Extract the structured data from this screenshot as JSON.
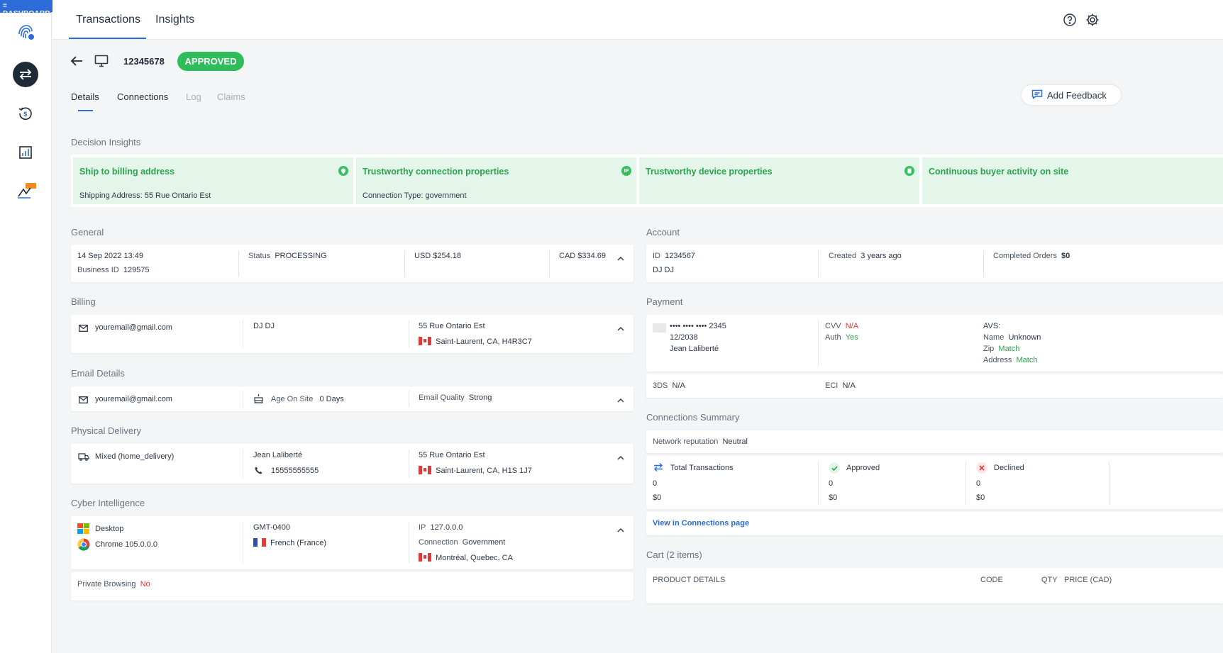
{
  "sidebar": {
    "badge": "= DASHBOARD",
    "beta": "BETA"
  },
  "top_tabs": [
    "Transactions",
    "Insights"
  ],
  "header": {
    "transaction_id": "12345678",
    "status": "APPROVED"
  },
  "sub_tabs": [
    "Details",
    "Connections",
    "Log",
    "Claims"
  ],
  "add_feedback": "Add Feedback",
  "decision_insights": {
    "title": "Decision Insights",
    "items": [
      {
        "title": "Ship to billing address",
        "detail": "Shipping Address: 55 Rue Ontario Est"
      },
      {
        "title": "Trustworthy connection properties",
        "detail": "Connection Type: government",
        "icon_text": "IP"
      },
      {
        "title": "Trustworthy device properties",
        "detail": ""
      },
      {
        "title": "Continuous buyer activity on site",
        "detail": ""
      }
    ]
  },
  "general": {
    "title": "General",
    "date": "14 Sep 2022 13:49",
    "business_id_label": "Business ID",
    "business_id": "129575",
    "status_label": "Status",
    "status": "PROCESSING",
    "usd": "USD $254.18",
    "cad": "CAD $334.69"
  },
  "billing": {
    "title": "Billing",
    "email": "youremail@gmail.com",
    "name": "DJ DJ",
    "address1": "55 Rue Ontario Est",
    "address2": "Saint-Laurent, CA, H4R3C7"
  },
  "email_details": {
    "title": "Email Details",
    "email": "youremail@gmail.com",
    "age_label": "Age On Site",
    "age": "0 Days",
    "quality_label": "Email Quality",
    "quality": "Strong"
  },
  "physical_delivery": {
    "title": "Physical Delivery",
    "method": "Mixed (home_delivery)",
    "name": "Jean Laliberté",
    "phone": "15555555555",
    "address1": "55 Rue Ontario Est",
    "address2": "Saint-Laurent, CA, H1S 1J7"
  },
  "cyber": {
    "title": "Cyber Intelligence",
    "device": "Desktop",
    "browser": "Chrome 105.0.0.0",
    "timezone": "GMT-0400",
    "language": "French (France)",
    "ip_label": "IP",
    "ip": "127.0.0.0",
    "connection_label": "Connection",
    "connection": "Government",
    "location": "Montréal, Quebec, CA",
    "private_label": "Private Browsing",
    "private": "No"
  },
  "account": {
    "title": "Account",
    "id_label": "ID",
    "id": "1234567",
    "name": "DJ DJ",
    "created_label": "Created",
    "created": "3 years ago",
    "orders_label": "Completed Orders",
    "orders": "$0"
  },
  "payment": {
    "title": "Payment",
    "card": "•••• •••• •••• 2345",
    "expiry": "12/2038",
    "holder": "Jean Laliberté",
    "cvv_label": "CVV",
    "cvv": "N/A",
    "auth_label": "Auth",
    "auth": "Yes",
    "avs_label": "AVS:",
    "avs_name_label": "Name",
    "avs_name": "Unknown",
    "avs_zip_label": "Zip",
    "avs_zip": "Match",
    "avs_address_label": "Address",
    "avs_address": "Match",
    "threeds_label": "3DS",
    "threeds": "N/A",
    "eci_label": "ECI",
    "eci": "N/A"
  },
  "connections_summary": {
    "title": "Connections Summary",
    "reputation_label": "Network reputation",
    "reputation": "Neutral",
    "total_label": "Total Transactions",
    "total_count": "0",
    "total_amount": "$0",
    "approved_label": "Approved",
    "approved_count": "0",
    "approved_amount": "$0",
    "declined_label": "Declined",
    "declined_count": "0",
    "declined_amount": "$0",
    "link": "View in Connections page"
  },
  "cart": {
    "title": "Cart (2 items)",
    "columns": [
      "PRODUCT DETAILS",
      "CODE",
      "QTY",
      "PRICE (CAD)"
    ]
  }
}
